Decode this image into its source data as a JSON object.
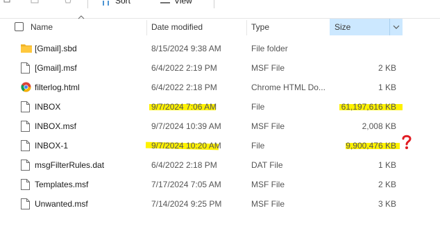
{
  "toolbar": {
    "sort_label": "Sort",
    "view_label": "View"
  },
  "columns": {
    "name": "Name",
    "date": "Date modified",
    "type": "Type",
    "size": "Size"
  },
  "rows": [
    {
      "name": "[Gmail].sbd",
      "date": "8/15/2024 9:38 AM",
      "type": "File folder",
      "size": "",
      "icon": "folder-icon"
    },
    {
      "name": "[Gmail].msf",
      "date": "6/4/2022 2:19 PM",
      "type": "MSF File",
      "size": "2 KB",
      "icon": "file-icon"
    },
    {
      "name": "filterlog.html",
      "date": "6/4/2022 2:18 PM",
      "type": "Chrome HTML Do...",
      "size": "1 KB",
      "icon": "chrome-icon"
    },
    {
      "name": "INBOX",
      "date": "9/7/2024 7:06 AM",
      "type": "File",
      "size": "61,197,616 KB",
      "icon": "file-icon"
    },
    {
      "name": "INBOX.msf",
      "date": "9/7/2024 10:39 AM",
      "type": "MSF File",
      "size": "2,008 KB",
      "icon": "file-icon"
    },
    {
      "name": "INBOX-1",
      "date": "9/7/2024 10:20 AM",
      "type": "File",
      "size": "9,900,476 KB",
      "icon": "file-icon"
    },
    {
      "name": "msgFilterRules.dat",
      "date": "6/4/2022 2:18 PM",
      "type": "DAT File",
      "size": "1 KB",
      "icon": "file-icon"
    },
    {
      "name": "Templates.msf",
      "date": "7/17/2024 7:05 AM",
      "type": "MSF File",
      "size": "2 KB",
      "icon": "file-icon"
    },
    {
      "name": "Unwanted.msf",
      "date": "7/14/2024 9:25 PM",
      "type": "MSF File",
      "size": "3 KB",
      "icon": "file-icon"
    }
  ],
  "annotations": {
    "highlight_color": "#fff200",
    "question_mark_color": "#e11b22"
  }
}
